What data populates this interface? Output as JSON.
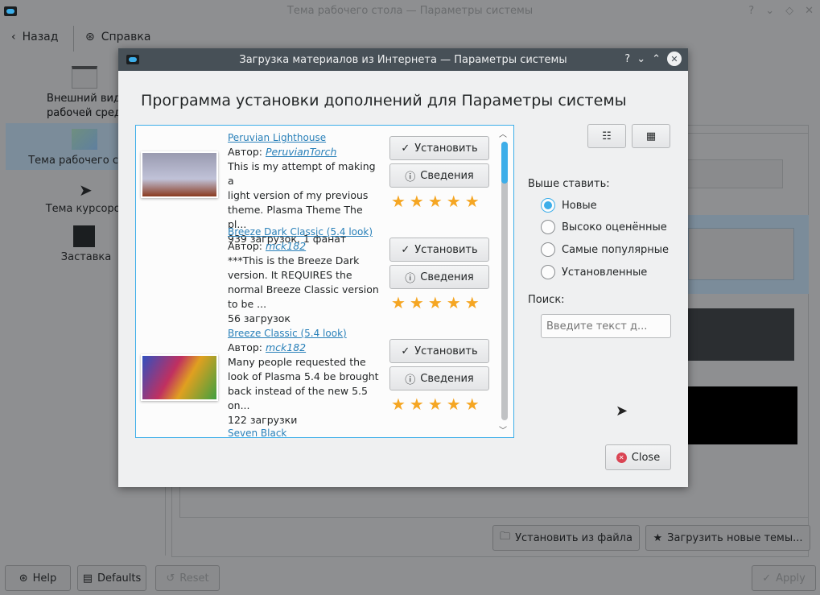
{
  "window": {
    "title": "Тема рабочего стола — Параметры системы",
    "controls": [
      "?",
      "⌄",
      "◇",
      "✕"
    ]
  },
  "toolbar": {
    "back": "Назад",
    "help": "Справка"
  },
  "sidebar": {
    "items": [
      {
        "label": "Внешний вид рабочей среды",
        "line1": "Внешний вид",
        "line2": "рабочей сред"
      },
      {
        "label": "Тема рабочего стола"
      },
      {
        "label": "Тема курсоров"
      },
      {
        "label": "Заставка"
      }
    ]
  },
  "panel": {
    "install_file": "Установить из файла",
    "get_new": "Загрузить новые темы..."
  },
  "footer": {
    "help": "Help",
    "defaults": "Defaults",
    "reset": "Reset",
    "apply": "Apply"
  },
  "dialog": {
    "title": "Загрузка материалов из Интернета — Параметры системы",
    "heading": "Программа установки дополнений для Параметры системы",
    "author_label": "Автор:",
    "install": "Установить",
    "details": "Сведения",
    "items": [
      {
        "title": "Peruvian Lighthouse",
        "author": "PeruvianTorch",
        "desc": [
          "This is my attempt of making a",
          "light version of my previous",
          "theme. Plasma Theme The pl..."
        ],
        "stats": "939 загрузок, 1 фанат",
        "rating": 5
      },
      {
        "title": "Breeze Dark Classic (5.4 look)",
        "author": "mck182",
        "desc": [
          "***This is the Breeze Dark",
          "version. It REQUIRES the",
          "normal Breeze Classic version",
          "to be ..."
        ],
        "stats": "56 загрузок",
        "rating": 5
      },
      {
        "title": "Breeze Classic (5.4 look)",
        "author": "mck182",
        "desc": [
          "Many people requested the",
          "look of Plasma 5.4 be brought",
          "back instead of the new 5.5",
          "on..."
        ],
        "stats": "122 загрузки",
        "rating": 5
      },
      {
        "title": "Seven Black"
      }
    ],
    "sort_label": "Выше ставить:",
    "sort_options": [
      "Новые",
      "Высоко оценённые",
      "Самые популярные",
      "Установленные"
    ],
    "sort_selected": "Новые",
    "search_label": "Поиск:",
    "search_placeholder": "Введите текст д...",
    "close": "Close",
    "colors": {
      "accent": "#3daee9",
      "titlebar": "#475057",
      "star": "#f5a623"
    }
  }
}
